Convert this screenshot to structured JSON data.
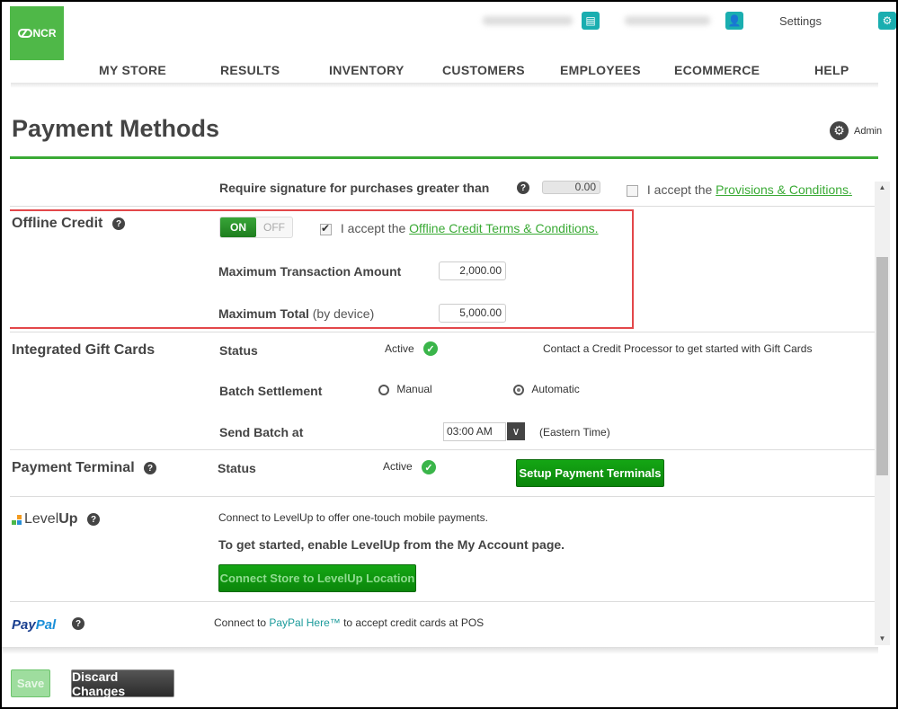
{
  "header": {
    "logo_text": "NCR",
    "settings_label": "Settings",
    "nav": [
      "MY STORE",
      "RESULTS",
      "INVENTORY",
      "CUSTOMERS",
      "EMPLOYEES",
      "ECOMMERCE",
      "HELP"
    ]
  },
  "page": {
    "title": "Payment Methods",
    "admin_label": "Admin"
  },
  "signature": {
    "label": "Require signature for purchases greater than",
    "value": "0.00",
    "accept_prefix": "I accept the ",
    "accept_link": "Provisions & Conditions.",
    "accepted": false
  },
  "offline_credit": {
    "title": "Offline Credit",
    "toggle_on": "ON",
    "toggle_off": "OFF",
    "enabled": true,
    "accept_prefix": "I accept the ",
    "accept_link": "Offline Credit Terms & Conditions.",
    "accepted": true,
    "max_transaction_label": "Maximum Transaction Amount",
    "max_transaction_value": "2,000.00",
    "max_total_label": "Maximum Total",
    "max_total_suffix": "(by device)",
    "max_total_value": "5,000.00"
  },
  "gift_cards": {
    "title": "Integrated Gift Cards",
    "status_label": "Status",
    "status_value": "Active",
    "note": "Contact a Credit Processor to get started with Gift Cards",
    "batch_label": "Batch Settlement",
    "batch_options": [
      "Manual",
      "Automatic"
    ],
    "batch_selected": "Automatic",
    "send_label": "Send Batch at",
    "send_time": "03:00 AM",
    "timezone": "(Eastern Time)"
  },
  "payment_terminal": {
    "title": "Payment Terminal",
    "status_label": "Status",
    "status_value": "Active",
    "setup_button": "Setup Payment Terminals"
  },
  "levelup": {
    "logo_text_light": "Level",
    "logo_text_bold": "Up",
    "description": "Connect to LevelUp to offer one-touch mobile payments.",
    "instruction": "To get started, enable LevelUp from the My Account page.",
    "connect_button": "Connect Store to LevelUp Location"
  },
  "paypal": {
    "logo_pay": "Pay",
    "logo_pal": "Pal",
    "desc_prefix": "Connect to ",
    "desc_link": "PayPal Here™",
    "desc_suffix": " to accept credit cards at POS"
  },
  "footer": {
    "save_label": "Save",
    "discard_label": "Discard Changes"
  },
  "colors": {
    "brand_green": "#4fb848",
    "accent_teal": "#1aaeb0",
    "highlight_red": "#e3474a",
    "link_green": "#3aaa35"
  }
}
